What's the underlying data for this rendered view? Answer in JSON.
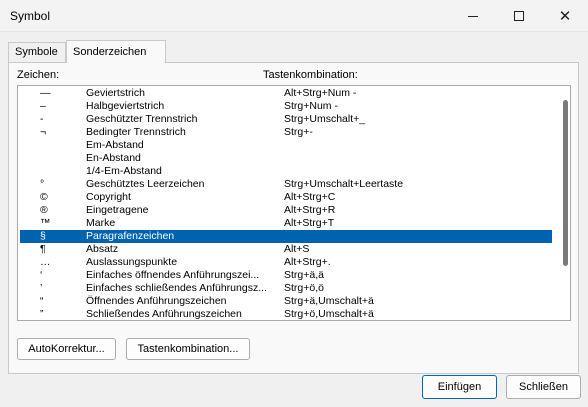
{
  "window": {
    "title": "Symbol"
  },
  "tabs": [
    {
      "label": "Symbole"
    },
    {
      "label": "Sonderzeichen"
    }
  ],
  "list": {
    "header_zeichen": "Zeichen:",
    "header_tasten": "Tastenkombination:",
    "rows": [
      {
        "char": "—",
        "name": "Geviertstrich",
        "shortcut": "Alt+Strg+Num -"
      },
      {
        "char": "–",
        "name": "Halbgeviertstrich",
        "shortcut": "Strg+Num -"
      },
      {
        "char": "-",
        "name": "Geschützter Trennstrich",
        "shortcut": "Strg+Umschalt+_"
      },
      {
        "char": "¬",
        "name": "Bedingter Trennstrich",
        "shortcut": "Strg+-"
      },
      {
        "char": "",
        "name": "Em-Abstand",
        "shortcut": ""
      },
      {
        "char": "",
        "name": "En-Abstand",
        "shortcut": ""
      },
      {
        "char": "",
        "name": "1/4-Em-Abstand",
        "shortcut": ""
      },
      {
        "char": "°",
        "name": "Geschütztes Leerzeichen",
        "shortcut": "Strg+Umschalt+Leertaste"
      },
      {
        "char": "©",
        "name": "Copyright",
        "shortcut": "Alt+Strg+C"
      },
      {
        "char": "®",
        "name": "Eingetragene",
        "shortcut": "Alt+Strg+R"
      },
      {
        "char": "™",
        "name": "Marke",
        "shortcut": "Alt+Strg+T"
      },
      {
        "char": "§",
        "name": "Paragrafenzeichen",
        "shortcut": ""
      },
      {
        "char": "¶",
        "name": "Absatz",
        "shortcut": "Alt+S"
      },
      {
        "char": "…",
        "name": "Auslassungspunkte",
        "shortcut": "Alt+Strg+."
      },
      {
        "char": "‘",
        "name": "Einfaches öffnendes Anführungszei...",
        "shortcut": "Strg+ä,ä"
      },
      {
        "char": "’",
        "name": "Einfaches schließendes Anführungsz...",
        "shortcut": "Strg+ö,ö"
      },
      {
        "char": "“",
        "name": "Öffnendes Anführungszeichen",
        "shortcut": "Strg+ä,Umschalt+ä"
      },
      {
        "char": "”",
        "name": "Schließendes Anführungszeichen",
        "shortcut": "Strg+ö,Umschalt+ä"
      }
    ]
  },
  "buttons": {
    "autokorrektur": "AutoKorrektur...",
    "tastenkombination": "Tastenkombination...",
    "einfuegen": "Einfügen",
    "schliessen": "Schließen"
  },
  "colors": {
    "selection": "#0063b1",
    "accent_border": "#0067c0"
  }
}
